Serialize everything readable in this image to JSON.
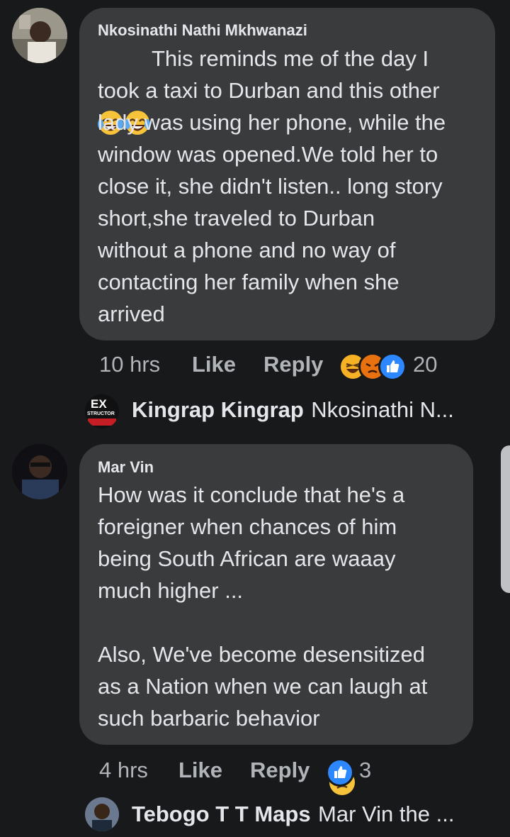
{
  "comments": [
    {
      "author": "Nkosinathi Nathi Mkhwanazi",
      "lines": [
        "This reminds me of the day I",
        "took a taxi to Durban and this other",
        "lady was using her phone, while the",
        "window was opened.We told her to",
        "close it, she didn't listen.. long story",
        "short,she traveled to Durban",
        "without a phone and no way of",
        "contacting her family when she",
        "arrived"
      ],
      "time": "10 hrs",
      "like_label": "Like",
      "reply_label": "Reply",
      "reaction_count": "20",
      "reactions": [
        "haha-icon",
        "angry-icon",
        "like-icon"
      ],
      "reply_preview": {
        "name": "Kingrap Kingrap",
        "snippet": "Nkosinathi N...",
        "avatar_text_top": "EX",
        "avatar_text_bottom": "STRUCTOR"
      }
    },
    {
      "author": "Mar Vin",
      "lines": [
        "How was it conclude that he's a",
        "foreigner when chances of him",
        "being South African are waaay",
        "much higher ...",
        "",
        "Also, We've become desensitized",
        "as a Nation when we can laugh at",
        "such barbaric behavior"
      ],
      "time": "4 hrs",
      "like_label": "Like",
      "reply_label": "Reply",
      "reaction_count": "3",
      "reactions": [
        "like-icon"
      ],
      "reply_preview": {
        "name": "Tebogo T T Maps",
        "snippet": "Mar Vin the ..."
      }
    }
  ],
  "colors": {
    "background": "#18191a",
    "bubble": "#3a3b3c",
    "text": "#e4e6eb",
    "meta": "#b0b3b8",
    "like_blue": "#2d88ff",
    "angry": "#e9710f",
    "haha": "#f7b125"
  }
}
